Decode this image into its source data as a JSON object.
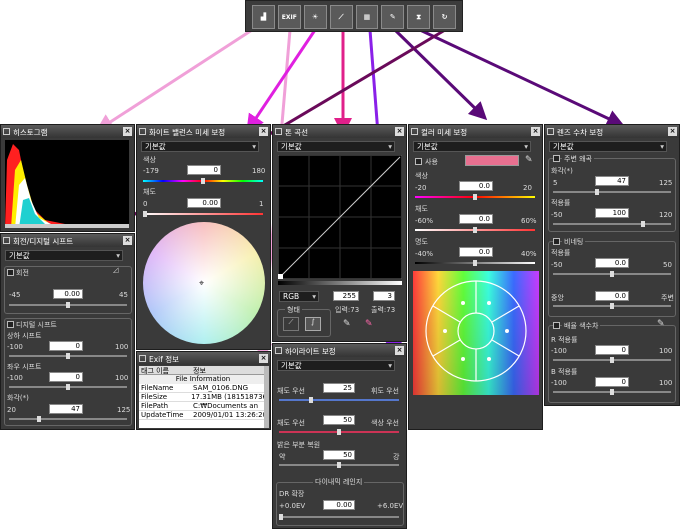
{
  "toolbar": {
    "buttons": [
      {
        "name": "histogram-icon",
        "glyph": "▟"
      },
      {
        "name": "exif-icon",
        "glyph": "EXIF"
      },
      {
        "name": "white-balance-icon",
        "glyph": "☀"
      },
      {
        "name": "tone-curve-icon",
        "glyph": "⟋"
      },
      {
        "name": "color-adjust-icon",
        "glyph": "▦"
      },
      {
        "name": "highlight-icon",
        "glyph": "✎"
      },
      {
        "name": "lens-correction-icon",
        "glyph": "⧗"
      },
      {
        "name": "rotate-icon",
        "glyph": "↻"
      }
    ]
  },
  "histogram": {
    "title": "히스토그램"
  },
  "rotation": {
    "title": "회전/디지털 시프트",
    "preset": "기본값",
    "rotate_label": "회전",
    "rotate_min": "-45",
    "rotate_val": "0.00",
    "rotate_max": "45",
    "shift_label": "디지털 시프트",
    "v_label": "상하 시프트",
    "v_min": "-100",
    "v_val": "0",
    "v_max": "100",
    "h_label": "좌우 시프트",
    "h_min": "-100",
    "h_val": "0",
    "h_max": "100",
    "ang_label": "화각(*)",
    "ang_min": "20",
    "ang_val": "47",
    "ang_max": "125"
  },
  "wb": {
    "title": "화이트 밸런스 미세 보정",
    "preset": "기본값",
    "hue_label": "색상",
    "hue_min": "-179",
    "hue_val": "0",
    "hue_max": "180",
    "sat_label": "채도",
    "sat_min": "0",
    "sat_val": "0.00",
    "sat_max": "1"
  },
  "exif": {
    "title": "Exif 정보",
    "col_tag": "태그 이름",
    "col_info": "정보",
    "section": "File Information",
    "rows": [
      [
        "FileName",
        "SAM_0106.DNG"
      ],
      [
        "FileSize",
        "17.31MB (181518736"
      ],
      [
        "FilePath",
        "C:₩Documents an"
      ],
      [
        "UpdateTime",
        "2009/01/01 13:26:20"
      ]
    ]
  },
  "curve": {
    "title": "톤 곡선",
    "preset": "기본값",
    "channel": "RGB",
    "max_val": "255",
    "out_val": "3",
    "input_label": "입력:73",
    "output_label": "출력:73",
    "shape_label": "형태"
  },
  "highlight": {
    "title": "하이라이트 보정",
    "preset": "기본값",
    "r1_left": "채도 우선",
    "r1_val": "25",
    "r1_right": "휘도 우선",
    "r2_left": "채도 우선",
    "r2_val": "50",
    "r2_right": "색상 우선",
    "bright_label": "밝은 부분 복원",
    "b_left": "약",
    "b_val": "50",
    "b_right": "강",
    "dr_group": "다이내믹 레인지",
    "dr_label": "DR 확장",
    "dr_min": "+0.0EV",
    "dr_val": "0.00",
    "dr_max": "+6.0EV"
  },
  "color": {
    "title": "컬러 미세 보정",
    "preset": "기본값",
    "use_label": "사용",
    "hue_label": "색상",
    "hue_min": "-20",
    "hue_val": "0.0",
    "hue_max": "20",
    "sat_label": "채도",
    "sat_min": "-60%",
    "sat_val": "0.0",
    "sat_max": "60%",
    "bri_label": "명도",
    "bri_min": "-40%",
    "bri_val": "0.0",
    "bri_max": "40%",
    "swatch": "#e87090"
  },
  "lens": {
    "title": "렌즈 수차 보정",
    "preset": "기본값",
    "dist_label": "주변 왜곡",
    "ang_label": "화각(*)",
    "ang_min": "5",
    "ang_val": "47",
    "ang_max": "125",
    "app_label": "적용률",
    "app_min": "-50",
    "app_val": "100",
    "app_max": "120",
    "vig_label": "비네팅",
    "vig_app_label": "적용률",
    "vig_min": "-50",
    "vig_val": "0.0",
    "vig_max": "50",
    "center_label": "중앙",
    "edge_label": "주변",
    "edge_val": "0.0",
    "ca_label": "배율 색수차",
    "r_label": "R 적용률",
    "r_min": "-100",
    "r_val": "0",
    "r_max": "100",
    "b_label": "B 적용률",
    "b_min": "-100",
    "b_val": "0",
    "b_max": "100"
  }
}
